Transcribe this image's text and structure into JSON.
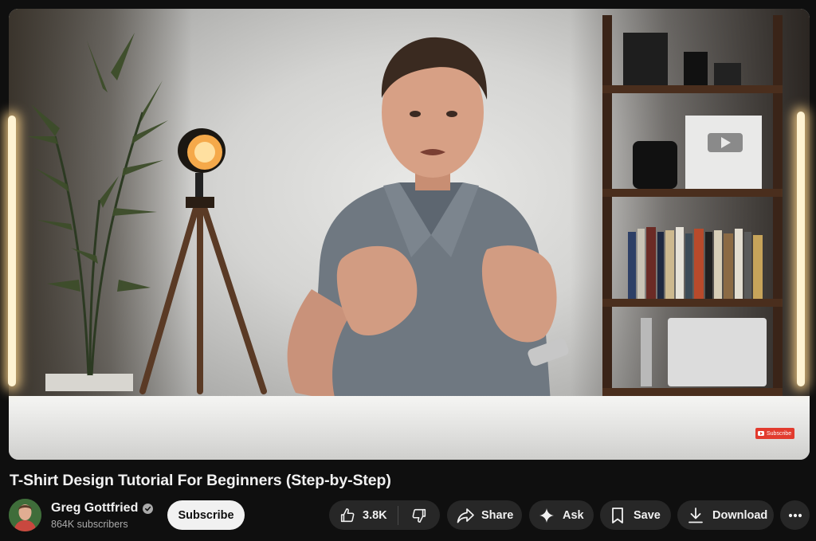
{
  "video": {
    "title": "T-Shirt Design Tutorial For Beginners (Step-by-Step)",
    "watermark_label": "Subscribe"
  },
  "owner": {
    "channel_name": "Greg Gottfried",
    "subscribers": "864K subscribers",
    "subscribe_label": "Subscribe"
  },
  "actions": {
    "like_count": "3.8K",
    "share_label": "Share",
    "ask_label": "Ask",
    "save_label": "Save",
    "download_label": "Download"
  },
  "icons": {
    "like": "thumbs-up-icon",
    "dislike": "thumbs-down-icon",
    "share": "share-arrow-icon",
    "ask": "sparkle-icon",
    "save": "bookmark-icon",
    "download": "download-icon",
    "more": "more-horizontal-icon",
    "verified": "verified-check-icon"
  },
  "colors": {
    "page_background": "#0f0f0f",
    "button_background": "#272727",
    "subscribe_background": "#f1f1f1",
    "primary_text": "#f1f1f1",
    "secondary_text": "#aaaaaa",
    "watermark_red": "#e23b2e"
  }
}
